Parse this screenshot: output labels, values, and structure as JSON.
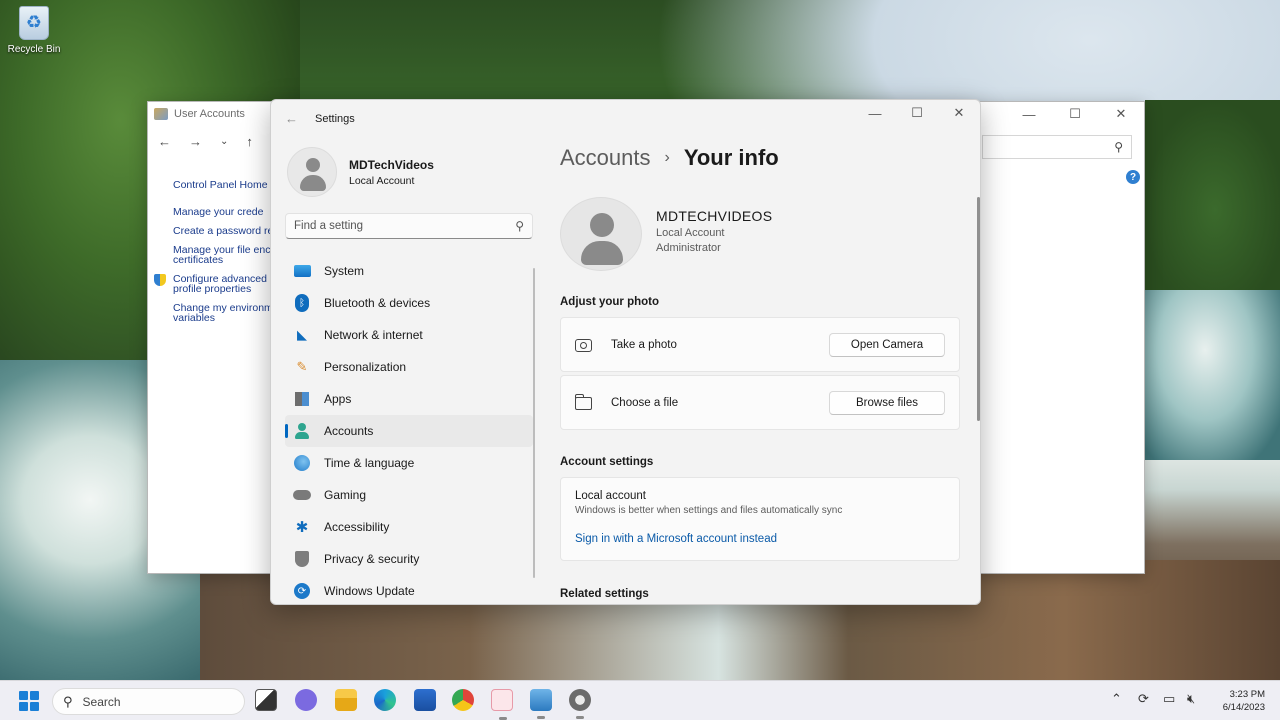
{
  "desktop": {
    "icons": [
      {
        "label": "Recycle Bin",
        "icon": "recycle-bin-icon"
      }
    ]
  },
  "user_accounts_window": {
    "title": "User Accounts",
    "controls": [
      "minimize",
      "maximize",
      "close"
    ],
    "nav_buttons": [
      "back",
      "forward",
      "dropdown",
      "up"
    ],
    "links": {
      "home": "Control Panel Home",
      "credentials": "Manage your crede",
      "reset_disk": "Create a password re",
      "encryption_1": "Manage your file enc",
      "encryption_2": "certificates",
      "advanced_1": "Configure advanced",
      "advanced_2": "profile properties",
      "environment_1": "Change my environm",
      "environment_2": "variables"
    }
  },
  "settings": {
    "title": "Settings",
    "profile": {
      "name": "MDTechVideos",
      "type": "Local Account"
    },
    "search": {
      "placeholder": "Find a setting"
    },
    "nav": [
      {
        "label": "System",
        "icon": "system-icon"
      },
      {
        "label": "Bluetooth & devices",
        "icon": "bluetooth-icon"
      },
      {
        "label": "Network & internet",
        "icon": "wifi-icon"
      },
      {
        "label": "Personalization",
        "icon": "brush-icon"
      },
      {
        "label": "Apps",
        "icon": "apps-icon"
      },
      {
        "label": "Accounts",
        "icon": "person-icon",
        "active": true
      },
      {
        "label": "Time & language",
        "icon": "globe-icon"
      },
      {
        "label": "Gaming",
        "icon": "gamepad-icon"
      },
      {
        "label": "Accessibility",
        "icon": "accessibility-icon"
      },
      {
        "label": "Privacy & security",
        "icon": "shield-icon"
      },
      {
        "label": "Windows Update",
        "icon": "update-icon"
      }
    ],
    "breadcrumb": {
      "parent": "Accounts",
      "separator": "›",
      "current": "Your info"
    },
    "user": {
      "name": "MDTECHVIDEOS",
      "type": "Local Account",
      "role": "Administrator"
    },
    "adjust_photo": {
      "heading": "Adjust your photo",
      "take_photo": {
        "label": "Take a photo",
        "button": "Open Camera"
      },
      "choose_file": {
        "label": "Choose a file",
        "button": "Browse files"
      }
    },
    "account_settings": {
      "heading": "Account settings",
      "title": "Local account",
      "description": "Windows is better when settings and files automatically sync",
      "link": "Sign in with a Microsoft account instead"
    },
    "related": {
      "heading": "Related settings"
    }
  },
  "taskbar": {
    "search_label": "Search",
    "apps": [
      "task-view-icon",
      "chat-icon",
      "file-explorer-icon",
      "edge-icon",
      "store-icon",
      "chrome-icon",
      "snipping-tool-icon",
      "control-panel-icon",
      "settings-icon"
    ],
    "clock": {
      "time": "3:23 PM",
      "date": "6/14/2023"
    }
  },
  "colors": {
    "accent": "#0067c0",
    "link": "#0a5aa8",
    "settings_bg": "#f3f3f3"
  }
}
